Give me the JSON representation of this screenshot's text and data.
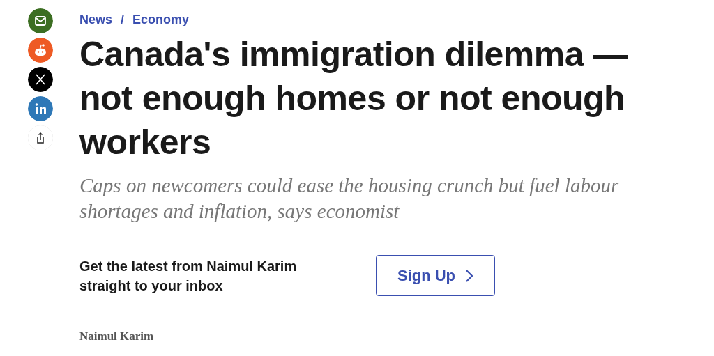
{
  "share_buttons": [
    {
      "kind": "email"
    },
    {
      "kind": "reddit"
    },
    {
      "kind": "x"
    },
    {
      "kind": "linkedin"
    },
    {
      "kind": "share"
    }
  ],
  "breadcrumb": [
    "News",
    "Economy"
  ],
  "breadcrumb_separator": "/",
  "headline": "Canada's immigration dilemma — not enough homes or not enough workers",
  "subheadline": "Caps on newcomers could ease the housing crunch but fuel labour shortages and inflation, says economist",
  "newsletter": {
    "text": "Get the latest from Naimul Karim straight to your inbox",
    "button": "Sign Up"
  },
  "author": "Naimul Karim"
}
